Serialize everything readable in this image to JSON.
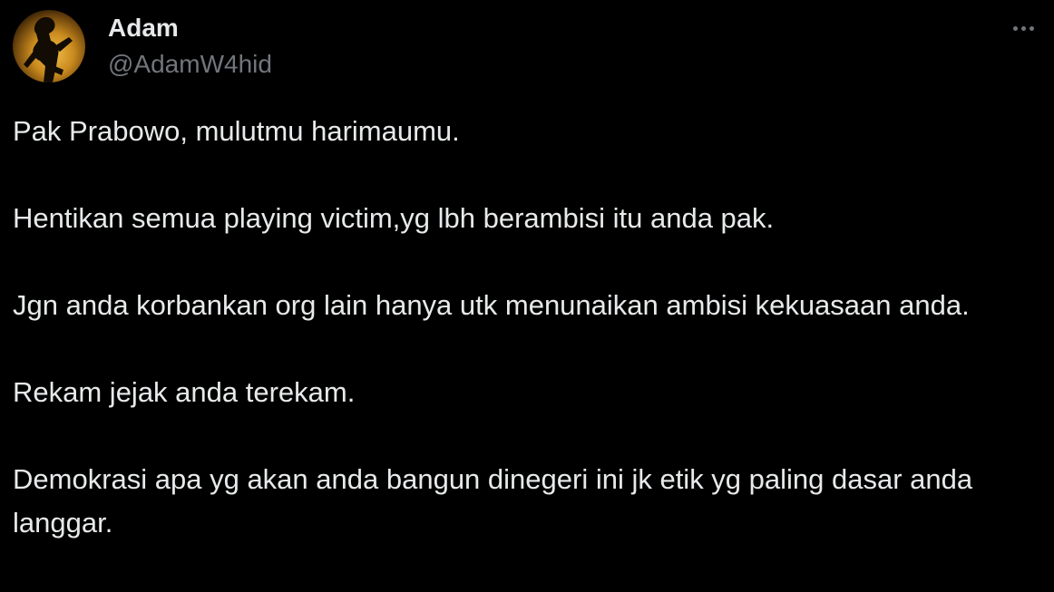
{
  "author": {
    "name": "Adam",
    "handle": "@AdamW4hid"
  },
  "more_menu_icon": "more-horizontal-icon",
  "avatar_icon": "wayang-puppet-avatar",
  "colors": {
    "background": "#000000",
    "text_primary": "#e7e9ea",
    "text_secondary": "#71767b"
  },
  "tweet": {
    "paragraphs": [
      "Pak Prabowo, mulutmu harimaumu.",
      "Hentikan semua playing victim,yg lbh berambisi itu anda pak.",
      "Jgn anda korbankan org lain hanya utk menunaikan ambisi kekuasaan anda.",
      "Rekam jejak anda terekam.",
      "Demokrasi apa yg akan anda bangun dinegeri ini jk etik yg paling dasar anda langgar."
    ]
  }
}
